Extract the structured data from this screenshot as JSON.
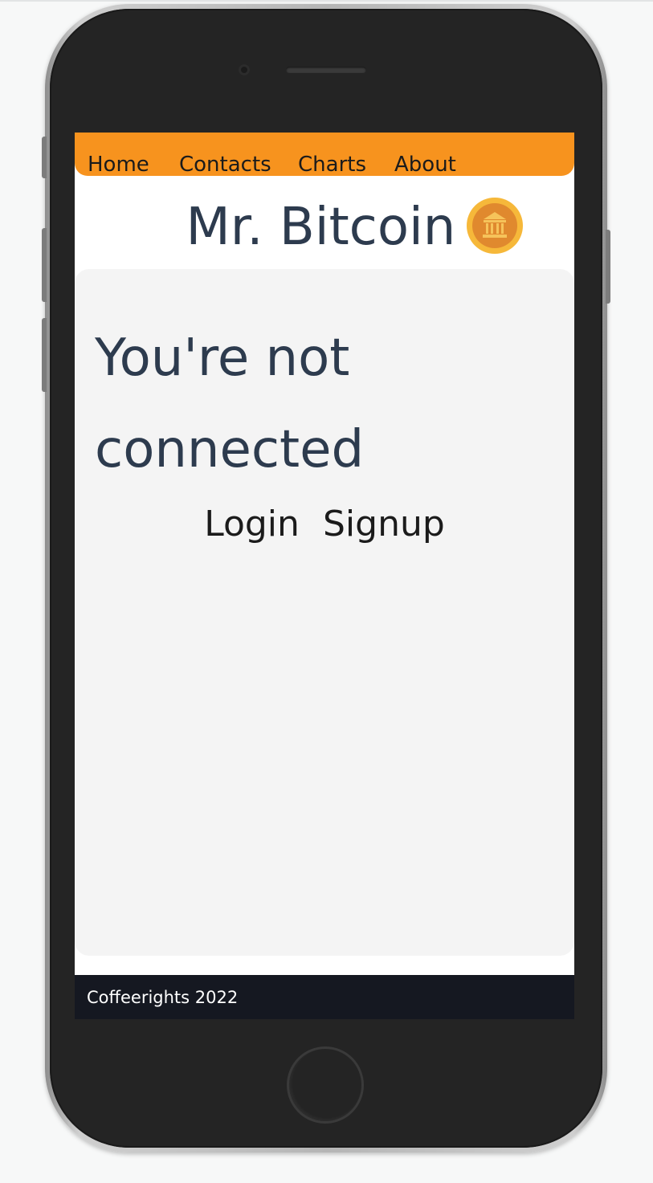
{
  "nav": {
    "items": [
      {
        "label": "Home"
      },
      {
        "label": "Contacts"
      },
      {
        "label": "Charts"
      },
      {
        "label": "About"
      }
    ]
  },
  "brand": {
    "title": "Mr. Bitcoin",
    "logo_icon": "bank-coin-icon",
    "logo_color": "#f6b83a"
  },
  "main": {
    "heading": "You're not connected",
    "login_label": "Login",
    "signup_label": "Signup"
  },
  "footer": {
    "text": "Coffeerights 2022"
  },
  "colors": {
    "navbar": "#f7931e",
    "footer": "#151821",
    "card": "#f4f4f4",
    "heading_text": "#2d3b4e"
  }
}
